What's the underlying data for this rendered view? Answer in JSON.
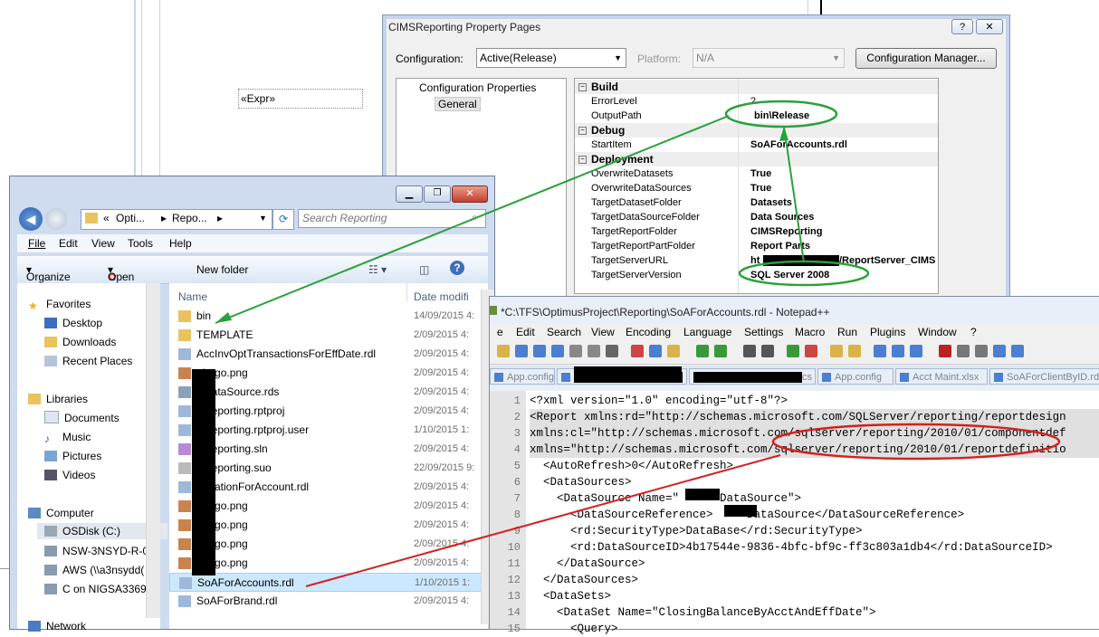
{
  "property_dialog": {
    "title": "CIMSReporting Property Pages",
    "help_button": "?",
    "close_button": "✕",
    "configuration_label": "Configuration:",
    "configuration_value": "Active(Release)",
    "platform_label": "Platform:",
    "platform_value": "N/A",
    "config_manager_button": "Configuration Manager...",
    "tree": {
      "root": "Configuration Properties",
      "child": "General"
    },
    "categories": {
      "build": "Build",
      "debug": "Debug",
      "deployment": "Deployment"
    },
    "props": [
      {
        "key": "ErrorLevel",
        "value": "2"
      },
      {
        "key": "OutputPath",
        "value": "bin\\Release"
      },
      {
        "key": "StartItem",
        "value": "SoAForAccounts.rdl"
      },
      {
        "key": "OverwriteDatasets",
        "value": "True"
      },
      {
        "key": "OverwriteDataSources",
        "value": "True"
      },
      {
        "key": "TargetDatasetFolder",
        "value": "Datasets"
      },
      {
        "key": "TargetDataSourceFolder",
        "value": "Data Sources"
      },
      {
        "key": "TargetReportFolder",
        "value": "CIMSReporting"
      },
      {
        "key": "TargetReportPartFolder",
        "value": "Report Parts"
      },
      {
        "key": "TargetServerURL",
        "value_prefix": "ht",
        "value_suffix": "/ReportServer_CIMS"
      },
      {
        "key": "TargetServerVersion",
        "value": "SQL Server 2008"
      }
    ]
  },
  "designer": {
    "expr_box": "«Expr»"
  },
  "explorer": {
    "breadcrumb": {
      "prefix": "«",
      "p1": "Opti...",
      "p2": "Repo..."
    },
    "search_placeholder": "Search Reporting",
    "menu": {
      "file": "File",
      "edit": "Edit",
      "view": "View",
      "tools": "Tools",
      "help": "Help"
    },
    "commands": {
      "organize": "Organize",
      "open": "Open",
      "new_folder": "New folder"
    },
    "columns": {
      "name": "Name",
      "date": "Date modifi"
    },
    "nav": {
      "favorites": "Favorites",
      "desktop": "Desktop",
      "downloads": "Downloads",
      "recent": "Recent Places",
      "libraries": "Libraries",
      "documents": "Documents",
      "music": "Music",
      "pictures": "Pictures",
      "videos": "Videos",
      "computer": "Computer",
      "osdisk": "OSDisk (C:)",
      "nsw": "NSW-3NSYD-R-0",
      "aws": "AWS (\\\\a3nsydd(",
      "con": "C on NIGSA33697",
      "network": "Network"
    },
    "files": [
      {
        "name": "bin",
        "date": "14/09/2015 4:"
      },
      {
        "name": "TEMPLATE",
        "date": "2/09/2015 4:"
      },
      {
        "name": "AccInvOptTransactionsForEffDate.rdl",
        "date": "2/09/2015 4:"
      },
      {
        "name": "_Logo.png",
        "date": "2/09/2015 4:"
      },
      {
        "name": "SDataSource.rds",
        "date": "2/09/2015 4:"
      },
      {
        "name": "SReporting.rptproj",
        "date": "2/09/2015 4:"
      },
      {
        "name": "SReporting.rptproj.user",
        "date": "1/10/2015 1:"
      },
      {
        "name": "SReporting.sln",
        "date": "2/09/2015 4:"
      },
      {
        "name": "SReporting.suo",
        "date": "22/09/2015 9:"
      },
      {
        "name": "firmationForAccount.rdl",
        "date": "2/09/2015 4:"
      },
      {
        "name": "_Logo.png",
        "date": "2/09/2015 4:"
      },
      {
        "name": "_Logo.png",
        "date": "2/09/2015 4:"
      },
      {
        "name": "_Logo.png",
        "date": "2/09/2015 4:"
      },
      {
        "name": "_Logo.png",
        "date": "2/09/2015 4:"
      },
      {
        "name": "SoAForAccounts.rdl",
        "date": "1/10/2015 1:"
      },
      {
        "name": "SoAForBrand.rdl",
        "date": "2/09/2015 4:"
      }
    ]
  },
  "notepad": {
    "title": "*C:\\TFS\\OptimusProject\\Reporting\\SoAForAccounts.rdl - Notepad++",
    "menu": [
      "e",
      "Edit",
      "Search",
      "View",
      "Encoding",
      "Language",
      "Settings",
      "Macro",
      "Run",
      "Plugins",
      "Window",
      "?"
    ],
    "tabs": [
      {
        "label": "App.config"
      },
      {
        "label": "cs"
      },
      {
        "label": "App.config"
      },
      {
        "label": "Acct Maint.xlsx"
      },
      {
        "label": "SoAForClientByID.rdl"
      }
    ],
    "lines": [
      {
        "n": "1",
        "text": "<?xml version=\"1.0\" encoding=\"utf-8\"?>"
      },
      {
        "n": "2",
        "text": "<Report xmlns:rd=\"http://schemas.microsoft.com/SQLServer/reporting/reportdesign"
      },
      {
        "n": "3",
        "text": "xmlns:cl=\"http://schemas.microsoft.com/sqlserver/reporting/2010/01/componentdef"
      },
      {
        "n": "4",
        "text": "xmlns=\"http://schemas.microsoft.com/sqlserver/reporting/2010/01/reportdefinitio"
      },
      {
        "n": "5",
        "text": "  <AutoRefresh>0</AutoRefresh>"
      },
      {
        "n": "6",
        "text": "  <DataSources>"
      },
      {
        "n": "7",
        "text": "    <DataSource Name=\"      DataSource\">"
      },
      {
        "n": "8",
        "text": "      <DataSourceReference>     DataSource</DataSourceReference>"
      },
      {
        "n": "9",
        "text": "      <rd:SecurityType>DataBase</rd:SecurityType>"
      },
      {
        "n": "10",
        "text": "      <rd:DataSourceID>4b17544e-9836-4bfc-bf9c-ff3c803a1db4</rd:DataSourceID>"
      },
      {
        "n": "11",
        "text": "    </DataSource>"
      },
      {
        "n": "12",
        "text": "  </DataSources>"
      },
      {
        "n": "13",
        "text": "  <DataSets>"
      },
      {
        "n": "14",
        "text": "    <DataSet Name=\"ClosingBalanceByAcctAndEffDate\">"
      },
      {
        "n": "15",
        "text": "      <Query>"
      }
    ]
  },
  "colors": {
    "green_annotation": "#2aa13a",
    "red_annotation": "#d42020",
    "selection": "#cce8ff"
  }
}
